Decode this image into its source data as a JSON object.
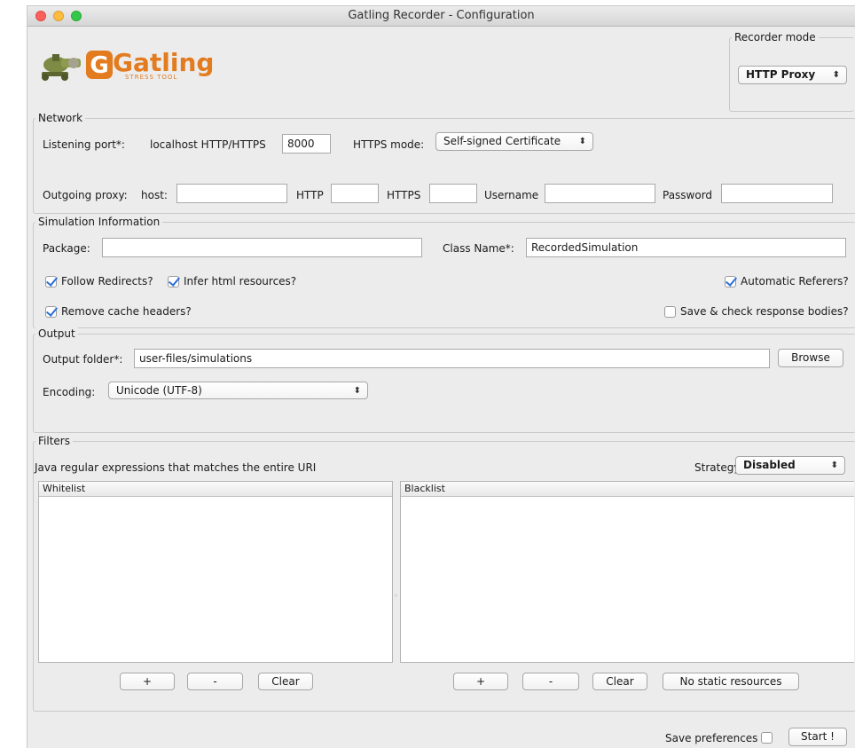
{
  "window": {
    "title": "Gatling Recorder - Configuration"
  },
  "logo": {
    "name": "Gatling",
    "tagline": "STRESS TOOL"
  },
  "recorder_mode": {
    "title": "Recorder mode",
    "value": "HTTP Proxy"
  },
  "network": {
    "title": "Network",
    "listening_port_label": "Listening port*:",
    "localhost_label": "localhost HTTP/HTTPS",
    "port_value": "8000",
    "https_mode_label": "HTTPS mode:",
    "https_mode_value": "Self-signed Certificate",
    "outgoing_proxy_label": "Outgoing proxy:",
    "host_label": "host:",
    "host_value": "",
    "http_label": "HTTP",
    "http_value": "",
    "https_label": "HTTPS",
    "https_value": "",
    "username_label": "Username",
    "username_value": "",
    "password_label": "Password",
    "password_value": ""
  },
  "simulation": {
    "title": "Simulation Information",
    "package_label": "Package:",
    "package_value": "",
    "class_name_label": "Class Name*:",
    "class_name_value": "RecordedSimulation",
    "follow_redirects": {
      "label": "Follow Redirects?",
      "checked": true
    },
    "infer_html": {
      "label": "Infer html resources?",
      "checked": true
    },
    "automatic_referers": {
      "label": "Automatic Referers?",
      "checked": true
    },
    "remove_cache": {
      "label": "Remove cache headers?",
      "checked": true
    },
    "save_check": {
      "label": "Save & check response bodies?",
      "checked": false
    }
  },
  "output": {
    "title": "Output",
    "folder_label": "Output folder*:",
    "folder_value": "user-files/simulations",
    "browse_label": "Browse",
    "encoding_label": "Encoding:",
    "encoding_value": "Unicode (UTF-8)"
  },
  "filters": {
    "title": "Filters",
    "description": "Java regular expressions that matches the entire URI",
    "strategy_label": "Strategy",
    "strategy_value": "Disabled",
    "whitelist_header": "Whitelist",
    "blacklist_header": "Blacklist",
    "add_label": "+",
    "remove_label": "-",
    "clear_label": "Clear",
    "no_static_label": "No static resources"
  },
  "footer": {
    "save_prefs_label": "Save preferences",
    "save_prefs_checked": false,
    "start_label": "Start !"
  },
  "colors": {
    "close": "#fc605b",
    "minimize": "#fdbc40",
    "maximize": "#34c84a",
    "logo_orange": "#e37b1f",
    "check": "#2a6fd6"
  }
}
